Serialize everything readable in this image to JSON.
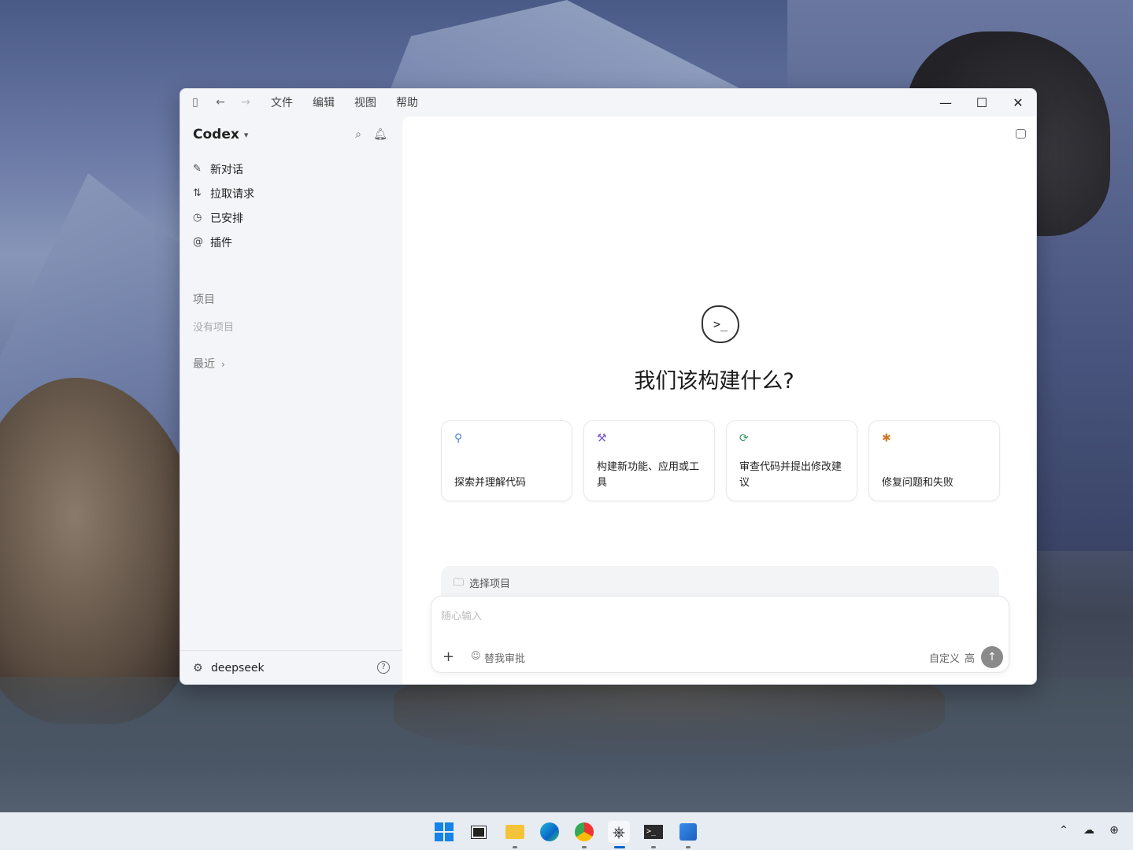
{
  "titlebar": {
    "menus": [
      "文件",
      "编辑",
      "视图",
      "帮助"
    ],
    "sidebar_icon": "sidebar-toggle-icon",
    "back_icon": "arrow-left-icon",
    "forward_icon": "arrow-right-icon",
    "minimize": "—",
    "maximize": "☐",
    "close": "✕"
  },
  "sidebar": {
    "brand": "Codex",
    "nav": [
      {
        "label": "新对话",
        "icon": "edit-icon",
        "glyph": "✎"
      },
      {
        "label": "拉取请求",
        "icon": "pull-request-icon",
        "glyph": "⇅"
      },
      {
        "label": "已安排",
        "icon": "clock-icon",
        "glyph": "◷"
      },
      {
        "label": "插件",
        "icon": "at-icon",
        "glyph": "@"
      }
    ],
    "projects_title": "项目",
    "projects_empty": "没有项目",
    "recent": "最近",
    "footer_user": "deepseek"
  },
  "main": {
    "heading": "我们该构建什么?",
    "logo_glyph": ">_",
    "cards": [
      {
        "label": "探索并理解代码",
        "icon": "telescope-icon",
        "glyph": "⚲",
        "color": "#4a7fd0"
      },
      {
        "label": "构建新功能、应用或工具",
        "icon": "hammer-icon",
        "glyph": "⚒",
        "color": "#7a5cd0"
      },
      {
        "label": "审查代码并提出修改建议",
        "icon": "refresh-icon",
        "glyph": "⟳",
        "color": "#2a9a5a"
      },
      {
        "label": "修复问题和失败",
        "icon": "bug-icon",
        "glyph": "✱",
        "color": "#d07a2a"
      }
    ],
    "project_select": "选择项目",
    "composer": {
      "placeholder": "随心输入",
      "approval": "替我审批",
      "custom": "自定义",
      "level": "高"
    }
  },
  "taskbar": {
    "apps": [
      "start-icon",
      "task-view-icon",
      "file-explorer-icon",
      "edge-icon",
      "chrome-icon",
      "chatgpt-icon",
      "terminal-icon",
      "photos-icon"
    ],
    "tray": [
      "chevron-up-icon",
      "cloud-off-icon",
      "network-icon"
    ]
  }
}
